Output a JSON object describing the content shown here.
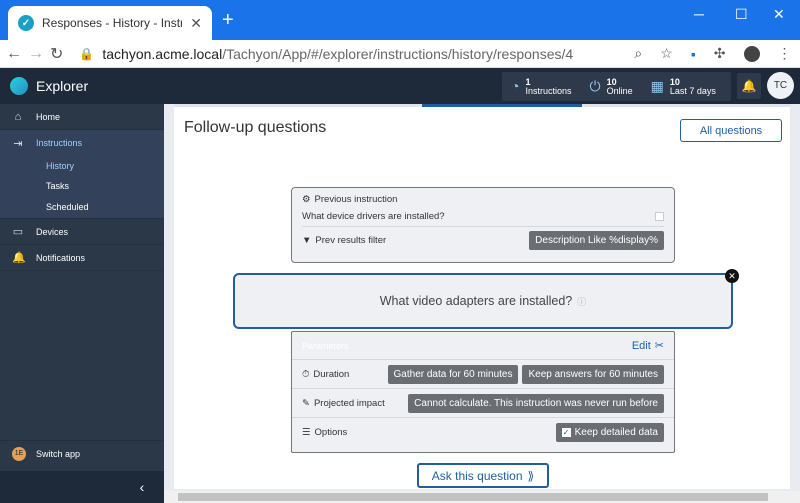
{
  "browser": {
    "tab_title": "Responses - History - Instruction",
    "url_host": "tachyon.acme.local",
    "url_path": "/Tachyon/App/#/explorer/instructions/history/responses/4",
    "window_controls": [
      "─",
      "☐",
      "✕"
    ]
  },
  "app": {
    "name": "Explorer",
    "stats": [
      {
        "value": "1",
        "label": "Instructions",
        "icon": "gauge-icon"
      },
      {
        "value": "10",
        "label": "Online",
        "icon": "power-icon"
      },
      {
        "value": "10",
        "label": "Last 7 days",
        "icon": "calendar-icon"
      }
    ],
    "user_initials": "TC"
  },
  "sidebar": {
    "items": [
      {
        "label": "Home",
        "icon": "home-icon"
      },
      {
        "label": "Instructions",
        "icon": "instructions-icon"
      },
      {
        "label": "Devices",
        "icon": "devices-icon"
      },
      {
        "label": "Notifications",
        "icon": "bell-icon"
      }
    ],
    "sub_items": [
      "History",
      "Tasks",
      "Scheduled"
    ],
    "switch_app": "Switch app",
    "switch_badge": "1E"
  },
  "main": {
    "title": "Follow-up questions",
    "all_questions": "All questions",
    "previous": {
      "heading": "Previous instruction",
      "question": "What device drivers are installed?",
      "filter_label": "Prev results filter",
      "filter_value": "Description Like %display%"
    },
    "question": "What video adapters are installed?",
    "params": {
      "heading": "Parameters",
      "edit": "Edit",
      "duration_label": "Duration",
      "gather": "Gather data for 60 minutes",
      "keep": "Keep answers for 60 minutes",
      "impact_label": "Projected impact",
      "impact_value": "Cannot calculate. This instruction was never run before",
      "options_label": "Options",
      "keep_detailed": "Keep detailed data"
    },
    "ask_button": "Ask this question"
  },
  "colors": {
    "accent": "#1f5fa0",
    "sidebar": "#2b3847",
    "header": "#1e2a3a",
    "chrome": "#1a73e8"
  }
}
